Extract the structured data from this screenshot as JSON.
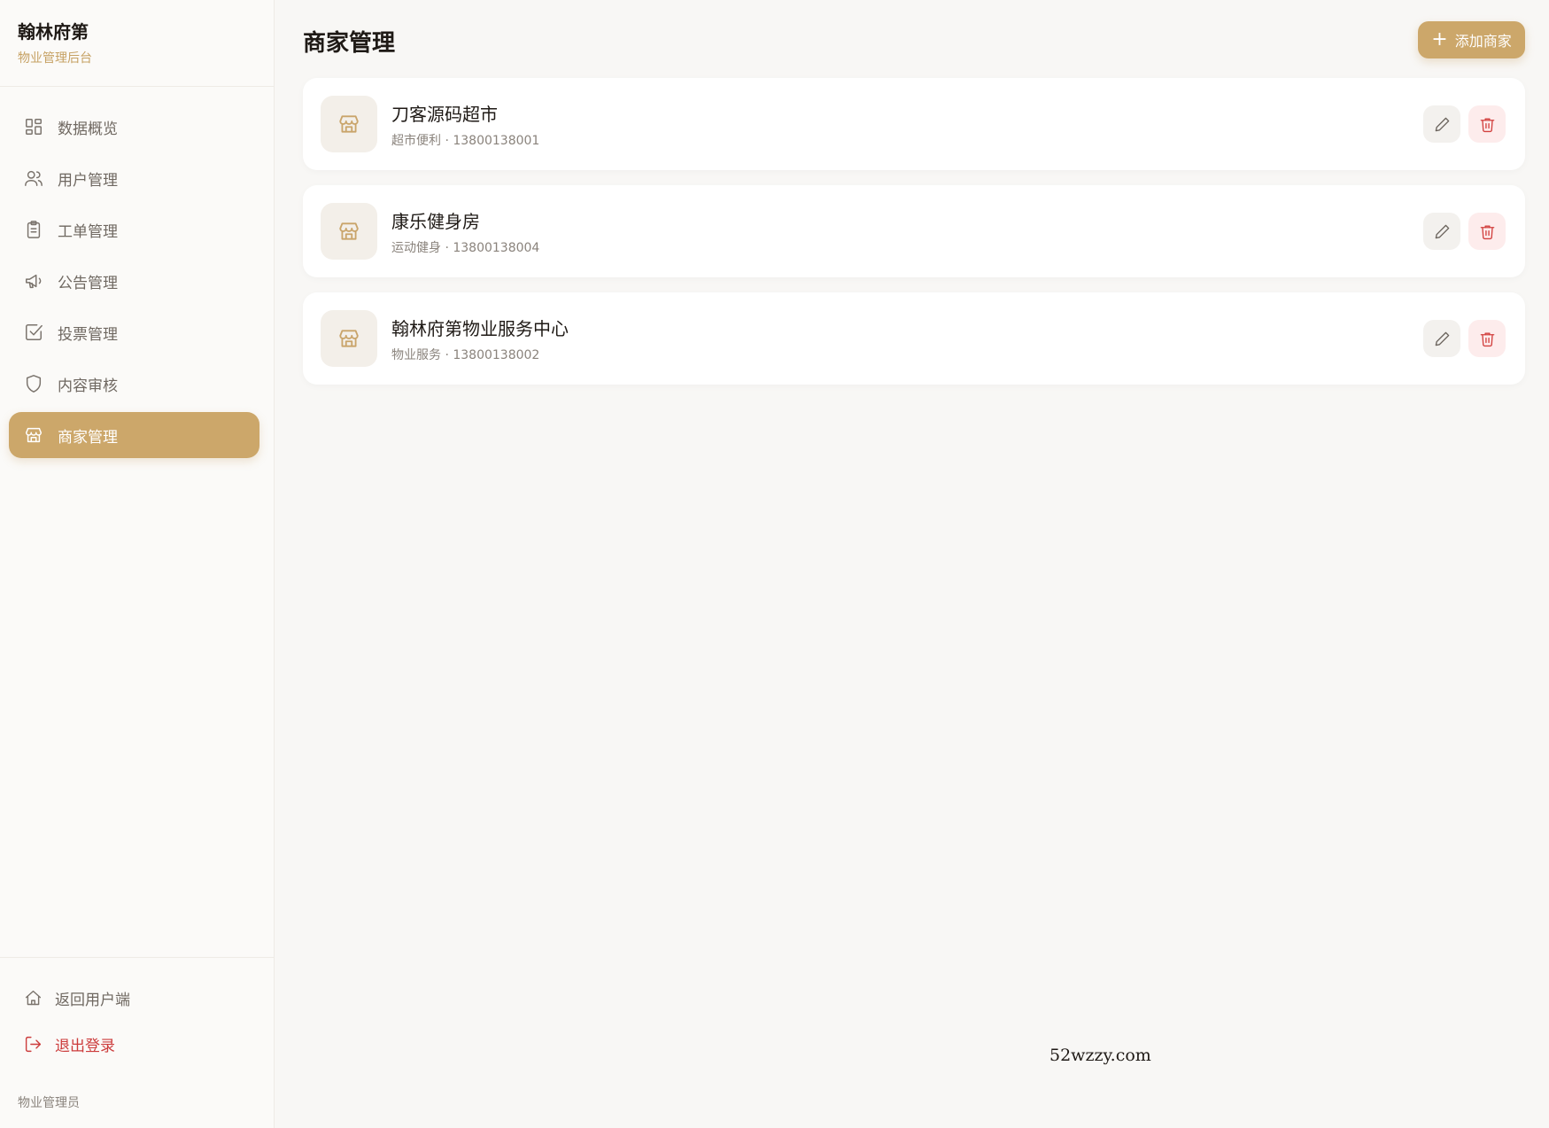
{
  "sidebar": {
    "brand_title": "翰林府第",
    "brand_subtitle": "物业管理后台",
    "items": [
      {
        "label": "数据概览",
        "icon": "dashboard-icon"
      },
      {
        "label": "用户管理",
        "icon": "users-icon"
      },
      {
        "label": "工单管理",
        "icon": "clipboard-icon"
      },
      {
        "label": "公告管理",
        "icon": "megaphone-icon"
      },
      {
        "label": "投票管理",
        "icon": "checkbox-icon"
      },
      {
        "label": "内容审核",
        "icon": "shield-icon"
      },
      {
        "label": "商家管理",
        "icon": "store-icon",
        "active": true
      }
    ],
    "back_label": "返回用户端",
    "logout_label": "退出登录",
    "role_label": "物业管理员"
  },
  "header": {
    "title": "商家管理",
    "add_button_label": "添加商家"
  },
  "merchants": [
    {
      "name": "刀客源码超市",
      "meta": "超市便利 · 13800138001"
    },
    {
      "name": "康乐健身房",
      "meta": "运动健身 · 13800138004"
    },
    {
      "name": "翰林府第物业服务中心",
      "meta": "物业服务 · 13800138002"
    }
  ],
  "watermark": "52wzzy.com",
  "colors": {
    "accent": "#cca76a",
    "danger": "#d2413f",
    "background": "#f8f7f5"
  }
}
